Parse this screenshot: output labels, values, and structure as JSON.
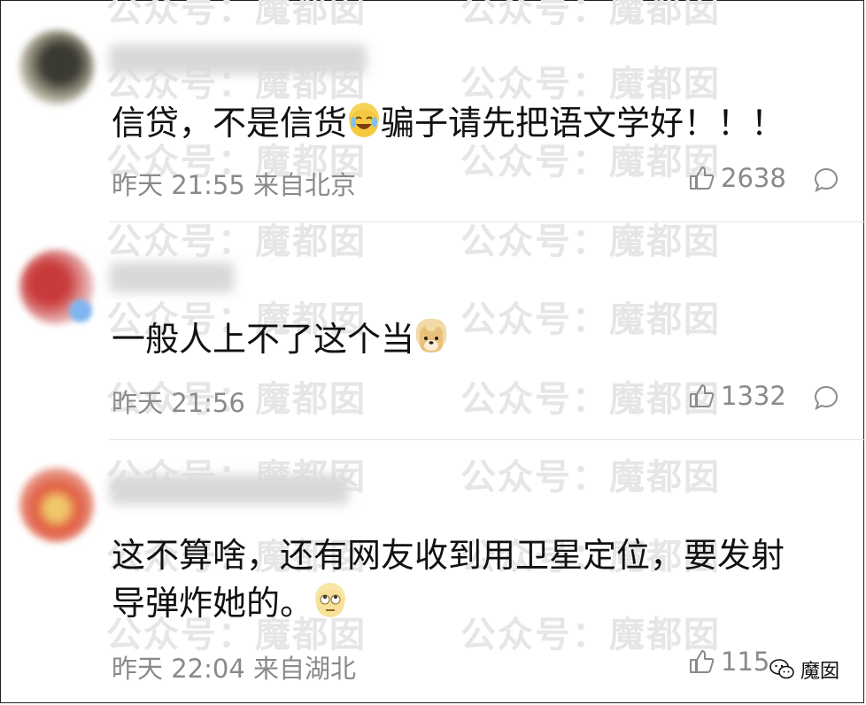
{
  "watermark": {
    "text": "公众号：魔都囡"
  },
  "comments": [
    {
      "text_before": "信贷，不是信货",
      "emoji": "laughing-tears-icon",
      "text_after": "骗子请先把语文学好！！！",
      "meta": "昨天 21:55 来自北京",
      "likes": "2638"
    },
    {
      "text_before": "一般人上不了这个当",
      "emoji": "doge-icon",
      "text_after": "",
      "meta": "昨天 21:56",
      "likes": "1332"
    },
    {
      "text_line1": "这不算啥，还有网友收到用卫星定位，要发射",
      "text_line2_before": "导弹炸她的。",
      "emoji": "eye-roll-icon",
      "meta": "昨天 22:04 来自湖北",
      "likes": "115"
    }
  ],
  "brand": {
    "label": "魔囡",
    "icon": "wechat-icon"
  },
  "colors": {
    "meta": "#8a8a8a",
    "text": "#111111",
    "watermark": "#e6e6e6"
  }
}
